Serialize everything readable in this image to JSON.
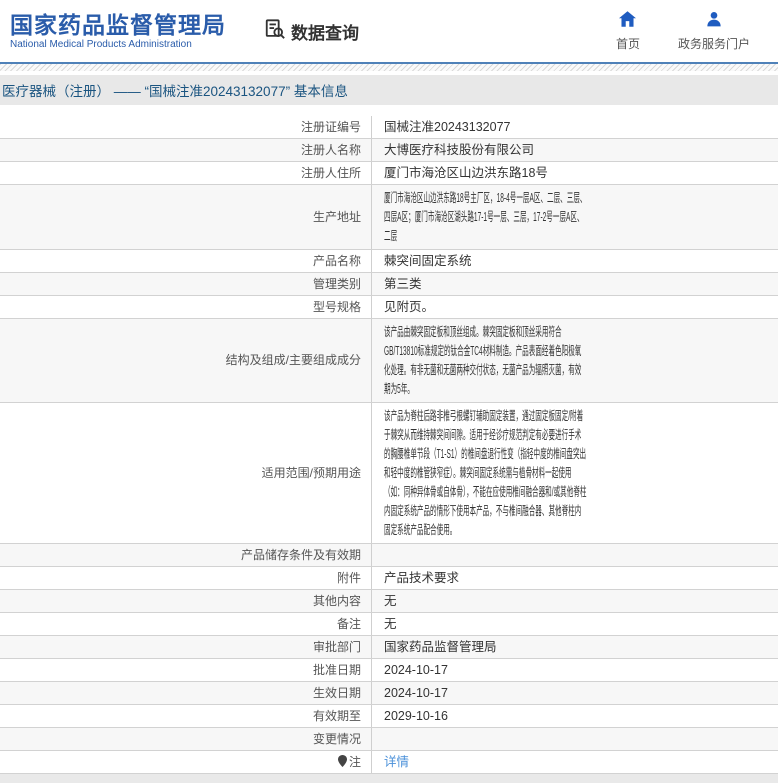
{
  "header": {
    "logo_title": "国家药品监督管理局",
    "logo_subtitle": "National Medical Products Administration",
    "section_label": "数据查询",
    "section_icon": "document-search-icon",
    "nav": [
      {
        "label": "首页",
        "icon": "home-icon"
      },
      {
        "label": "政务服务门户",
        "icon": "user-icon"
      }
    ]
  },
  "breadcrumb": "医疗器械（注册） ——  “国械注准20243132077”  基本信息",
  "table": {
    "rows": [
      {
        "label": "注册证编号",
        "value": "国械注准20243132077",
        "type": "text",
        "dense": false
      },
      {
        "label": "注册人名称",
        "value": "大博医疗科技股份有限公司",
        "type": "text",
        "dense": false
      },
      {
        "label": "注册人住所",
        "value": "厦门市海沧区山边洪东路18号",
        "type": "text",
        "dense": false
      },
      {
        "label": "生产地址",
        "value": "厦门市海沧区山边洪东路18号主厂区，18-4号一层A区、二层、三层、四层A区；厦门市海沧区湖头路17-1号一层、三层，17-2号一层A区、二层",
        "type": "text",
        "dense": true
      },
      {
        "label": "产品名称",
        "value": "棘突间固定系统",
        "type": "text",
        "dense": false
      },
      {
        "label": "管理类别",
        "value": "第三类",
        "type": "text",
        "dense": false
      },
      {
        "label": "型号规格",
        "value": "见附页。",
        "type": "text",
        "dense": false
      },
      {
        "label": "结构及组成/主要组成成分",
        "value": "该产品由棘突固定板和顶丝组成。棘突固定板和顶丝采用符合GB/T13810标准规定的钛合金TC4材料制造。产品表面经着色阳极氧化处理。有非无菌和无菌两种交付状态，无菌产品为辐照灭菌，有效期为5年。",
        "type": "text",
        "dense": true
      },
      {
        "label": "适用范围/预期用途",
        "value": "该产品为脊柱后路非椎弓根螺钉辅助固定装置，通过固定板固定/附着于棘突从而维持棘突间间隙。适用于经诊疗规范判定有必要进行手术的胸腰椎单节段（T1-S1）的椎间盘退行性变（指轻中度的椎间盘突出和轻中度的椎管狭窄症）。棘突间固定系统需与植骨材料一起使用（如：同种异体骨或自体骨），不能在应使用椎间融合器和/或其他脊柱内固定系统产品的情形下使用本产品，不与椎间融合器、其他脊柱内固定系统产品配合使用。",
        "type": "text",
        "dense": true
      },
      {
        "label": "产品储存条件及有效期",
        "value": "",
        "type": "empty",
        "dense": false
      },
      {
        "label": "附件",
        "value": "产品技术要求",
        "type": "text",
        "dense": false
      },
      {
        "label": "其他内容",
        "value": "无",
        "type": "text",
        "dense": false
      },
      {
        "label": "备注",
        "value": "无",
        "type": "text",
        "dense": false
      },
      {
        "label": "审批部门",
        "value": "国家药品监督管理局",
        "type": "text",
        "dense": false
      },
      {
        "label": "批准日期",
        "value": "2024-10-17",
        "type": "text",
        "dense": false
      },
      {
        "label": "生效日期",
        "value": "2024-10-17",
        "type": "text",
        "dense": false
      },
      {
        "label": "有效期至",
        "value": "2029-10-16",
        "type": "text",
        "dense": false
      },
      {
        "label": "变更情况",
        "value": "",
        "type": "empty",
        "dense": false
      },
      {
        "label": "注",
        "label_icon": "note-pin-icon",
        "value": "详情",
        "type": "link",
        "dense": false
      }
    ]
  },
  "colors": {
    "brand_blue": "#2a5caa",
    "icon_blue": "#1f5cc0",
    "divider_blue": "#4f81b8",
    "breadcrumb_text": "#1a5480",
    "breadcrumb_bg": "#e8e8e8",
    "row_alt_bg": "#f7f7f7",
    "table_border": "#cfcfcf",
    "link_blue": "#4a90d9"
  }
}
